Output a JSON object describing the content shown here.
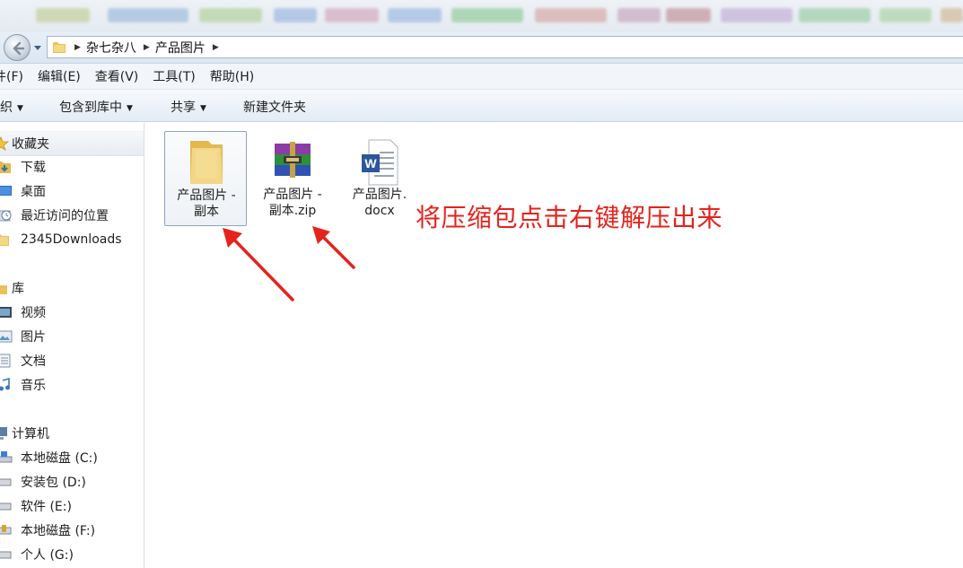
{
  "address_bar": {
    "breadcrumbs": [
      "杂七杂八",
      "产品图片"
    ]
  },
  "menu": {
    "items": [
      "件(F)",
      "编辑(E)",
      "查看(V)",
      "工具(T)",
      "帮助(H)"
    ]
  },
  "toolbar": {
    "organize": "织",
    "include_in_library": "包含到库中",
    "share": "共享",
    "new_folder": "新建文件夹"
  },
  "nav": {
    "favorites": {
      "header": "收藏夹",
      "items": [
        "下载",
        "桌面",
        "最近访问的位置",
        "2345Downloads"
      ]
    },
    "libraries": {
      "header": "库",
      "items": [
        "视频",
        "图片",
        "文档",
        "音乐"
      ]
    },
    "computer": {
      "header": "计算机",
      "items": [
        "本地磁盘 (C:)",
        "安装包 (D:)",
        "软件 (E:)",
        "本地磁盘 (F:)",
        "个人 (G:)"
      ]
    }
  },
  "files": [
    {
      "line1": "产品图片 -",
      "line2": "副本",
      "type": "folder-icon"
    },
    {
      "line1": "产品图片 -",
      "line2": "副本.zip",
      "type": "winrar-archive-icon"
    },
    {
      "line1": "产品图片.",
      "line2": "docx",
      "type": "word-document-icon"
    }
  ],
  "annotation": {
    "text": "将压缩包点击右键解压出来",
    "color": "#e5231c"
  },
  "colors": {
    "accent_arrow": "#e5231c",
    "folder": "#f1d27a"
  }
}
